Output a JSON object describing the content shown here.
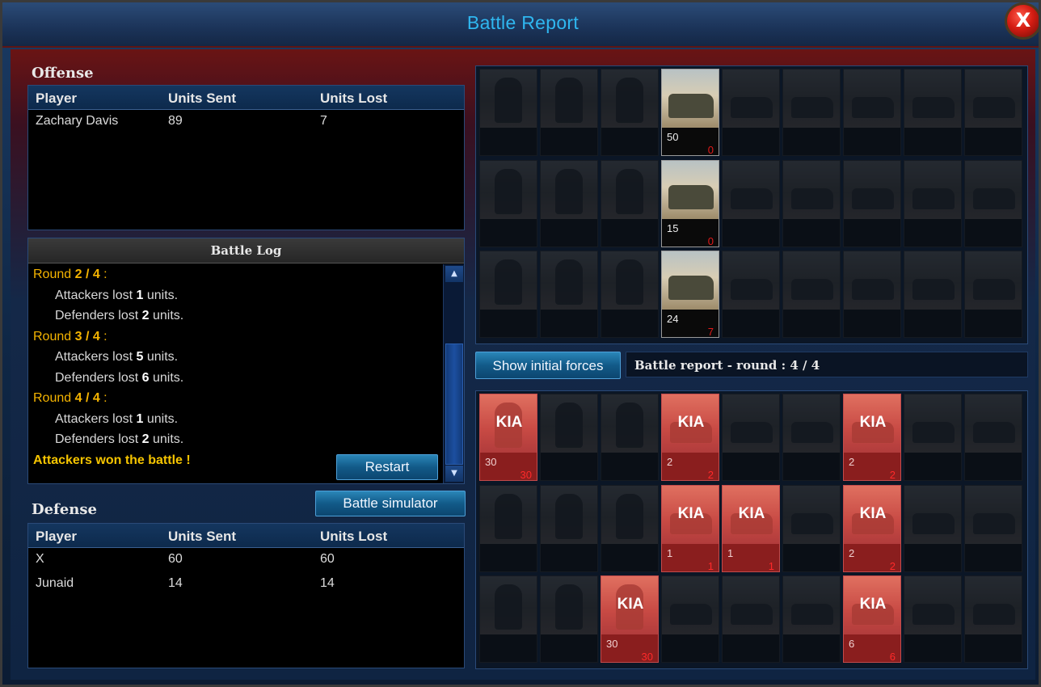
{
  "window": {
    "title": "Battle Report",
    "close_glyph": "X"
  },
  "offense": {
    "title": "Offense",
    "columns": [
      "Player",
      "Units Sent",
      "Units Lost"
    ],
    "rows": [
      {
        "player": "Zachary Davis",
        "sent": "89",
        "lost": "7"
      }
    ]
  },
  "battle_log": {
    "title": "Battle Log",
    "lines": [
      {
        "type": "round",
        "text": "Round ",
        "round": "2 / 4",
        "tail": " :"
      },
      {
        "type": "loss",
        "pre": "Attackers lost ",
        "num": "1",
        "post": " units."
      },
      {
        "type": "loss",
        "pre": "Defenders lost ",
        "num": "2",
        "post": " units."
      },
      {
        "type": "round",
        "text": "Round ",
        "round": "3 / 4",
        "tail": " :"
      },
      {
        "type": "loss",
        "pre": "Attackers lost ",
        "num": "5",
        "post": " units."
      },
      {
        "type": "loss",
        "pre": "Defenders lost ",
        "num": "6",
        "post": " units."
      },
      {
        "type": "round",
        "text": "Round ",
        "round": "4 / 4",
        "tail": " :"
      },
      {
        "type": "loss",
        "pre": "Attackers lost ",
        "num": "1",
        "post": " units."
      },
      {
        "type": "loss",
        "pre": "Defenders lost ",
        "num": "2",
        "post": " units."
      },
      {
        "type": "won",
        "text": "Attackers won the battle !"
      }
    ],
    "restart_label": "Restart"
  },
  "simulator_label": "Battle simulator",
  "defense": {
    "title": "Defense",
    "columns": [
      "Player",
      "Units Sent",
      "Units Lost"
    ],
    "rows": [
      {
        "player": "X",
        "sent": "60",
        "lost": "60"
      },
      {
        "player": "Junaid",
        "sent": "14",
        "lost": "14"
      }
    ]
  },
  "show_initial_label": "Show initial forces",
  "round_label": "Battle report - round : 4 / 4",
  "attacker_grid": [
    [
      {
        "t": "inf"
      },
      {
        "t": "inf"
      },
      {
        "t": "inf"
      },
      {
        "t": "veh",
        "active": true,
        "count": "50",
        "lost": "0"
      },
      {
        "t": "veh"
      },
      {
        "t": "veh"
      },
      {
        "t": "veh"
      },
      {
        "t": "veh"
      },
      {
        "t": "veh"
      }
    ],
    [
      {
        "t": "inf"
      },
      {
        "t": "inf"
      },
      {
        "t": "inf"
      },
      {
        "t": "veh",
        "active": true,
        "count": "15",
        "lost": "0"
      },
      {
        "t": "veh"
      },
      {
        "t": "veh"
      },
      {
        "t": "veh"
      },
      {
        "t": "veh"
      },
      {
        "t": "veh"
      }
    ],
    [
      {
        "t": "inf"
      },
      {
        "t": "inf"
      },
      {
        "t": "inf"
      },
      {
        "t": "veh",
        "active": true,
        "count": "24",
        "lost": "7"
      },
      {
        "t": "veh"
      },
      {
        "t": "veh"
      },
      {
        "t": "veh"
      },
      {
        "t": "veh"
      },
      {
        "t": "veh"
      }
    ]
  ],
  "defender_grid": [
    [
      {
        "t": "inf",
        "kia": true,
        "count": "30",
        "lost": "30"
      },
      {
        "t": "inf"
      },
      {
        "t": "inf"
      },
      {
        "t": "veh",
        "kia": true,
        "count": "2",
        "lost": "2"
      },
      {
        "t": "veh"
      },
      {
        "t": "veh"
      },
      {
        "t": "veh",
        "kia": true,
        "count": "2",
        "lost": "2"
      },
      {
        "t": "veh"
      },
      {
        "t": "veh"
      }
    ],
    [
      {
        "t": "inf"
      },
      {
        "t": "inf"
      },
      {
        "t": "inf"
      },
      {
        "t": "veh",
        "kia": true,
        "count": "1",
        "lost": "1"
      },
      {
        "t": "veh",
        "kia": true,
        "count": "1",
        "lost": "1"
      },
      {
        "t": "veh"
      },
      {
        "t": "veh",
        "kia": true,
        "count": "2",
        "lost": "2"
      },
      {
        "t": "veh"
      },
      {
        "t": "veh"
      }
    ],
    [
      {
        "t": "inf"
      },
      {
        "t": "inf"
      },
      {
        "t": "inf",
        "kia": true,
        "count": "30",
        "lost": "30"
      },
      {
        "t": "veh"
      },
      {
        "t": "veh"
      },
      {
        "t": "veh"
      },
      {
        "t": "veh",
        "kia": true,
        "count": "6",
        "lost": "6"
      },
      {
        "t": "veh"
      },
      {
        "t": "veh"
      }
    ]
  ],
  "kia_label": "KIA",
  "colors": {
    "title": "#2fb7f0",
    "round_yellow": "#f5b400",
    "lost_red": "#e21a1a",
    "kia_bg": "#c84a44"
  }
}
